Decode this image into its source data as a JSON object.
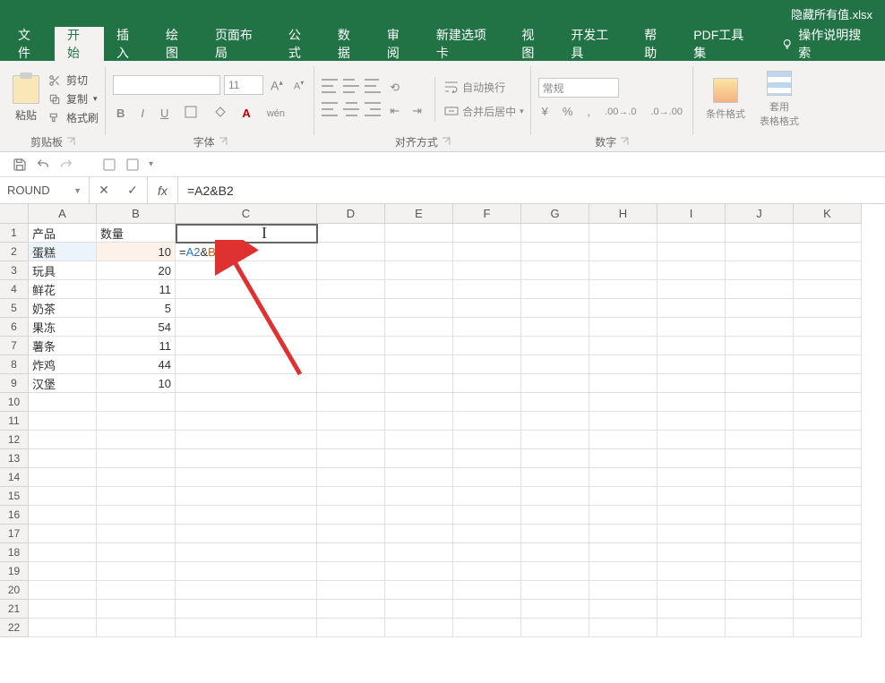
{
  "title_bar": {
    "filename": "隐藏所有值.xlsx"
  },
  "tabs": {
    "file": "文件",
    "home": "开始",
    "insert": "插入",
    "draw": "绘图",
    "page_layout": "页面布局",
    "formulas": "公式",
    "data": "数据",
    "review": "审阅",
    "new_tab": "新建选项卡",
    "view": "视图",
    "developer": "开发工具",
    "help": "帮助",
    "pdf": "PDF工具集",
    "search": "操作说明搜索"
  },
  "ribbon": {
    "clipboard": {
      "paste": "粘贴",
      "cut": "剪切",
      "copy": "复制",
      "format_painter": "格式刷",
      "label": "剪贴板"
    },
    "font": {
      "size": "11",
      "label": "字体",
      "bold": "B",
      "italic": "I",
      "underline": "U",
      "increase": "A",
      "decrease": "A"
    },
    "alignment": {
      "wrap": "自动换行",
      "merge": "合并后居中",
      "label": "对齐方式"
    },
    "number": {
      "format": "常规",
      "label": "数字"
    },
    "styles": {
      "cond": "条件格式",
      "table": "套用\n表格格式"
    }
  },
  "formula_bar": {
    "name_box": "ROUND",
    "formula": "=A2&B2"
  },
  "grid": {
    "columns": [
      "A",
      "B",
      "C",
      "D",
      "E",
      "F",
      "G",
      "H",
      "I",
      "J",
      "K"
    ],
    "rows": 22,
    "headers": {
      "A1": "产品",
      "B1": "数量"
    },
    "data": [
      {
        "a": "蛋糕",
        "b": 10
      },
      {
        "a": "玩具",
        "b": 20
      },
      {
        "a": "鲜花",
        "b": 11
      },
      {
        "a": "奶茶",
        "b": 5
      },
      {
        "a": "果冻",
        "b": 54
      },
      {
        "a": "薯条",
        "b": 11
      },
      {
        "a": "炸鸡",
        "b": 44
      },
      {
        "a": "汉堡",
        "b": 10
      }
    ],
    "active_cell": {
      "address": "C2",
      "formula_parts": {
        "eq": "=",
        "ref1": "A2",
        "op": "&",
        "ref2": "B2"
      }
    }
  }
}
